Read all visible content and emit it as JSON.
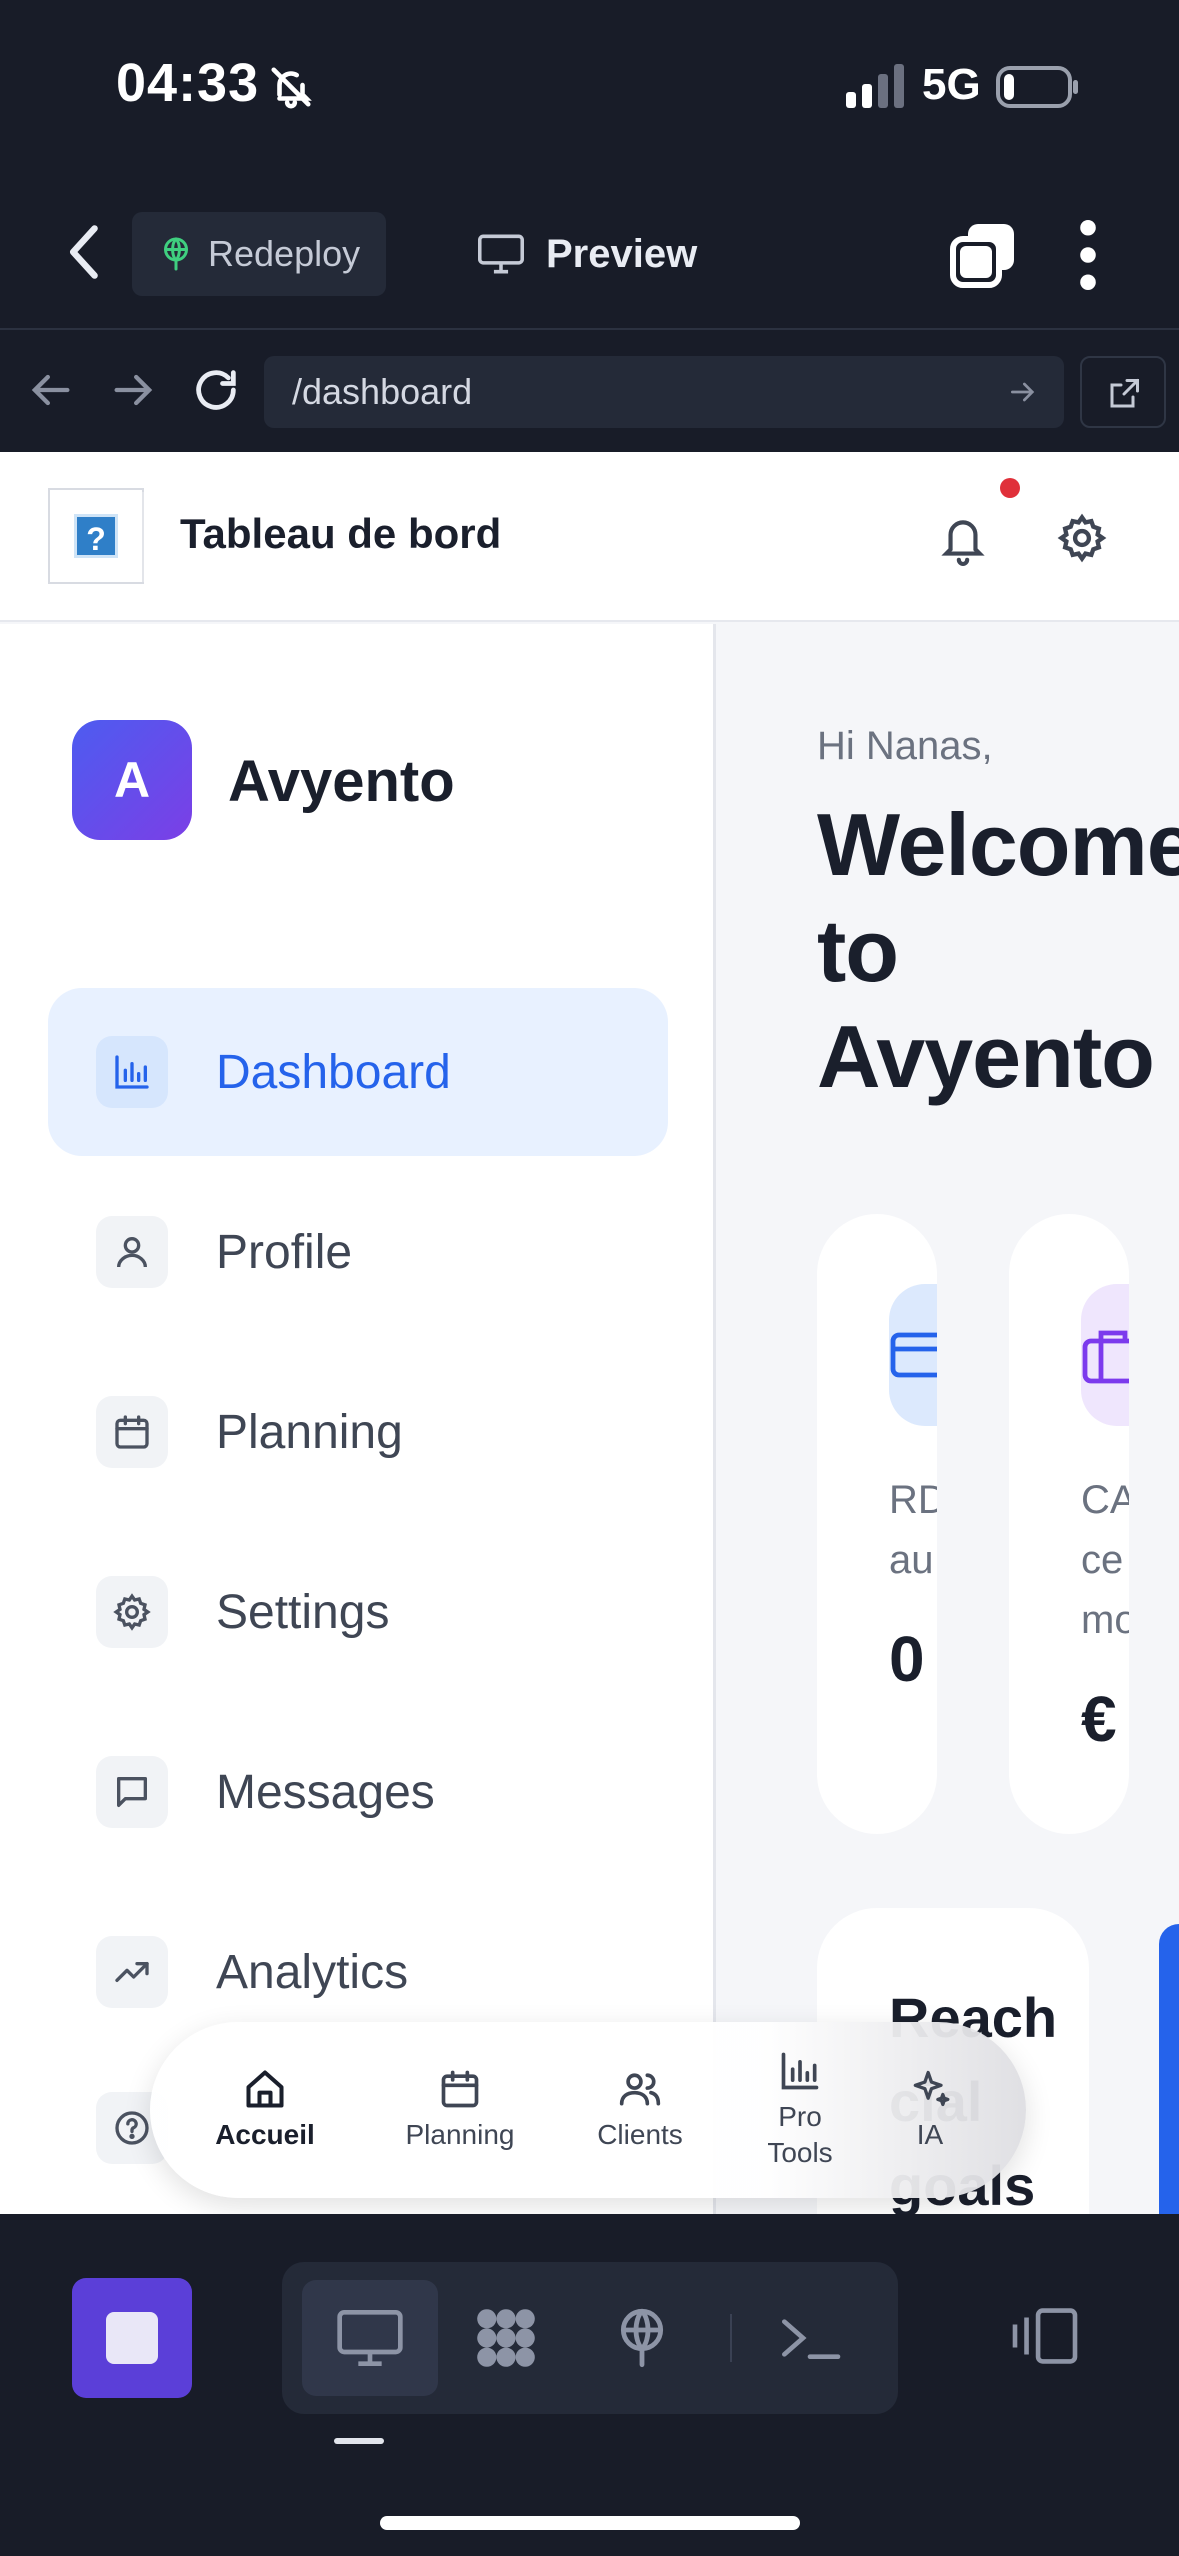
{
  "status_bar": {
    "time": "04:33",
    "network": "5G"
  },
  "toolbar": {
    "redeploy_label": "Redeploy",
    "preview_label": "Preview"
  },
  "url_bar": {
    "url": "/dashboard"
  },
  "page_header": {
    "title": "Tableau de bord",
    "logo_glyph": "?"
  },
  "sidebar": {
    "brand_initial": "A",
    "brand_name": "Avyento",
    "items": [
      {
        "label": "Dashboard",
        "icon": "bar-chart-icon",
        "active": true
      },
      {
        "label": "Profile",
        "icon": "user-icon",
        "active": false
      },
      {
        "label": "Planning",
        "icon": "calendar-icon",
        "active": false
      },
      {
        "label": "Settings",
        "icon": "gear-icon",
        "active": false
      },
      {
        "label": "Messages",
        "icon": "message-icon",
        "active": false
      },
      {
        "label": "Analytics",
        "icon": "trending-up-icon",
        "active": false
      }
    ]
  },
  "main": {
    "greeting": "Hi Nanas,",
    "welcome_line1": "Welcome",
    "welcome_line2": "to",
    "welcome_line3": "Avyento",
    "cards": [
      {
        "line1": "RD",
        "line2": "au",
        "value": "0",
        "accent": "#2563eb"
      },
      {
        "line1": "CA",
        "line2": "ce",
        "line3": "mo",
        "value": "€",
        "accent": "#7c3aed"
      }
    ],
    "goal_line1": "Reach",
    "goal_line2": "cial",
    "goal_line3": "goals"
  },
  "bottom_nav": {
    "items": [
      {
        "label": "Accueil",
        "icon": "home-icon",
        "active": true
      },
      {
        "label": "Planning",
        "icon": "calendar-icon",
        "active": false
      },
      {
        "label": "Clients",
        "icon": "users-icon",
        "active": false
      },
      {
        "label": "Pro\nTools",
        "icon": "bar-chart-icon",
        "active": false
      },
      {
        "label": "IA",
        "icon": "sparkles-icon",
        "active": false
      }
    ]
  },
  "colors": {
    "accent_blue": "#2563eb",
    "brand_gradient_start": "#4d5cf0",
    "brand_gradient_end": "#7b3fe6",
    "notification_dot": "#e0303a",
    "stop_button": "#5b3fd8"
  }
}
